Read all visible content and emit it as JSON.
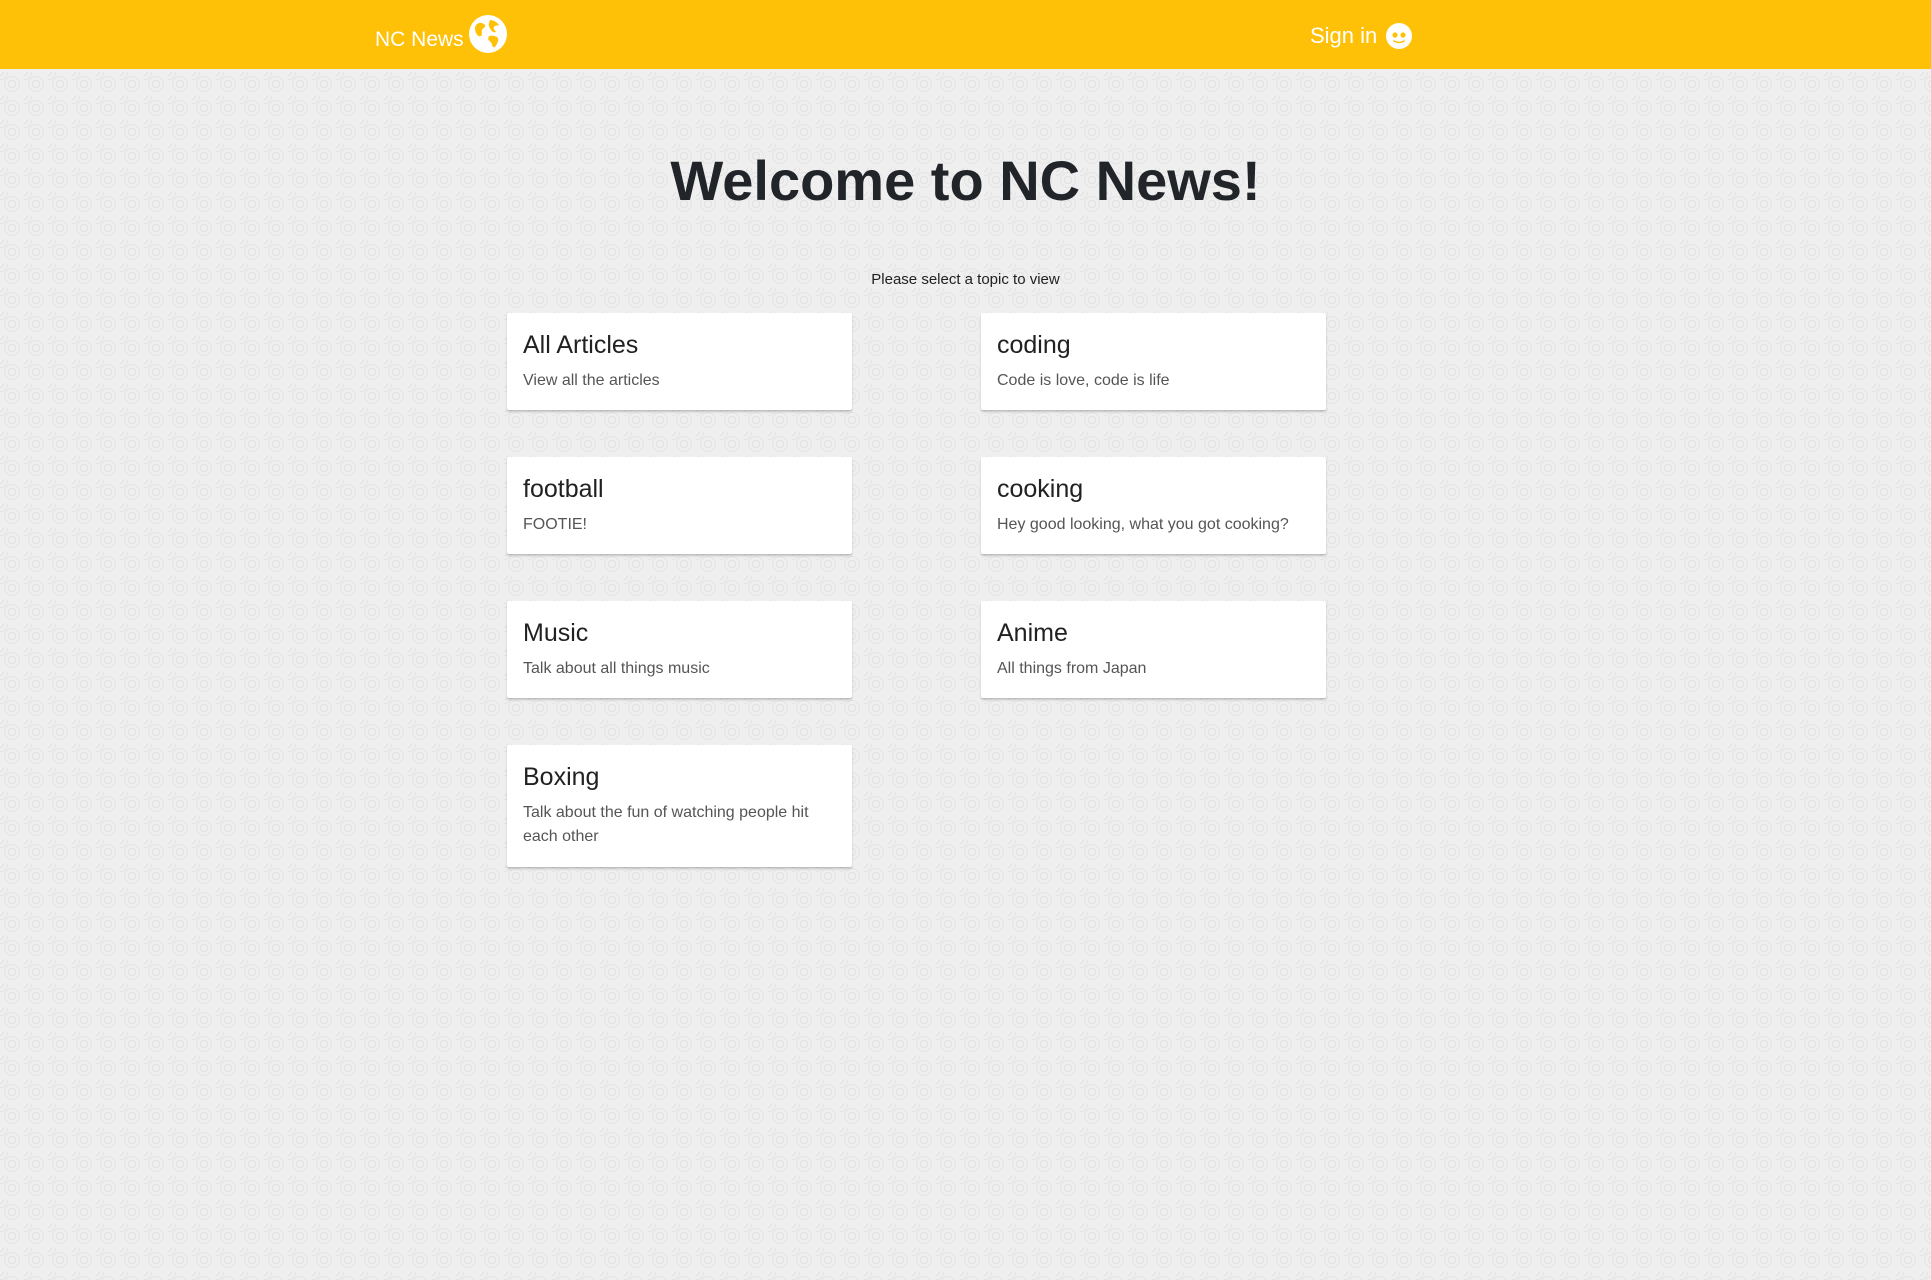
{
  "header": {
    "brand_label": "NC News",
    "brand_icon": "globe-icon",
    "signin_label": "Sign in",
    "signin_icon": "smiley-face-icon",
    "bar_color": "#ffc107"
  },
  "main": {
    "title": "Welcome to NC News!",
    "subtitle": "Please select a topic to view",
    "topics": [
      {
        "title": "All Articles",
        "description": "View all the articles"
      },
      {
        "title": "coding",
        "description": "Code is love, code is life"
      },
      {
        "title": "football",
        "description": "FOOTIE!"
      },
      {
        "title": "cooking",
        "description": "Hey good looking, what you got cooking?"
      },
      {
        "title": "Music",
        "description": "Talk about all things music"
      },
      {
        "title": "Anime",
        "description": "All things from Japan"
      },
      {
        "title": "Boxing",
        "description": "Talk about the fun of watching people hit each other"
      }
    ]
  }
}
